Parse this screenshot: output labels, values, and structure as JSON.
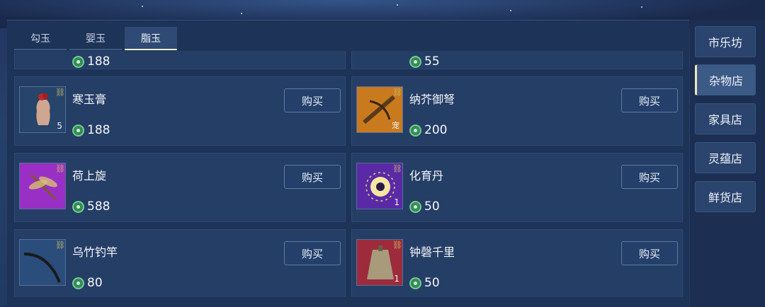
{
  "tabs": [
    "勾玉",
    "婴玉",
    "脂玉"
  ],
  "active_tab": 2,
  "top_partial": {
    "left_price": "188",
    "right_price": "55"
  },
  "items": [
    {
      "name": "寒玉膏",
      "price": "188",
      "qty": "5",
      "buy": "购买",
      "thumb_color": "#27446b",
      "icon": "vase-icon"
    },
    {
      "name": "纳芥御弩",
      "price": "200",
      "qty": "宠",
      "buy": "购买",
      "thumb_color": "#c97a1f",
      "icon": "crossbow-icon"
    },
    {
      "name": "荷上旋",
      "price": "588",
      "qty": "",
      "buy": "购买",
      "thumb_color": "#9a2fc5",
      "icon": "dragonfly-icon"
    },
    {
      "name": "化育丹",
      "price": "50",
      "qty": "1",
      "buy": "购买",
      "thumb_color": "#5a2aa6",
      "icon": "pill-icon"
    },
    {
      "name": "乌竹钓竿",
      "price": "80",
      "qty": "",
      "buy": "购买",
      "thumb_color": "#2a4d7c",
      "icon": "fishing-rod-icon"
    },
    {
      "name": "钟磬千里",
      "price": "50",
      "qty": "1",
      "buy": "购买",
      "thumb_color": "#9d2b3c",
      "icon": "bell-icon"
    }
  ],
  "sidebar": [
    "市乐坊",
    "杂物店",
    "家具店",
    "灵蕴店",
    "鲜货店"
  ],
  "active_side": 1
}
